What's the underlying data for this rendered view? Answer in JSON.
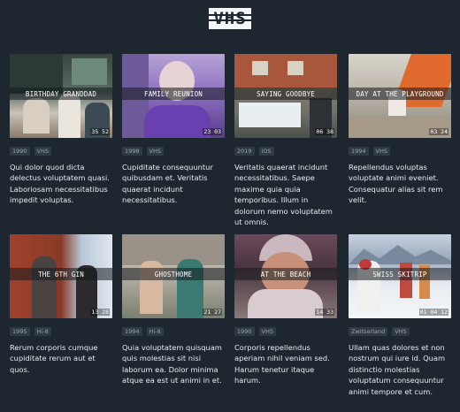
{
  "header": {
    "logo_text": "VHS"
  },
  "videos": [
    {
      "title": "BIRTHDAY GRANDDAD",
      "duration": "35 52",
      "tags": [
        "1990",
        "VHS"
      ],
      "description": "Qui dolor quod dicta delectus voluptatem quasi. Laboriosam necessitatibus impedit voluptas."
    },
    {
      "title": "FAMILY REUNION",
      "duration": "23 03",
      "tags": [
        "1998",
        "VHS"
      ],
      "description": "Cupiditate consequuntur quibusdam et. Veritatis quaerat incidunt necessitatibus."
    },
    {
      "title": "SAYING GOODBYE",
      "duration": "06 38",
      "tags": [
        "2019",
        "iOS"
      ],
      "description": "Veritatis quaerat incidunt necessitatibus. Saepe maxime quia quia temporibus. Illum in dolorum nemo voluptatem ut omnis."
    },
    {
      "title": "DAY AT THE PLAYGROUND",
      "duration": "03 24",
      "tags": [
        "1994",
        "VHS"
      ],
      "description": "Repellendus voluptas voluptate animi eveniet. Consequatur alias sit rem velit."
    },
    {
      "title": "THE 6TH GIN",
      "duration": "13 28",
      "tags": [
        "1995",
        "Hi-8"
      ],
      "description": "Rerum corporis cumque cupiditate rerum aut et quos."
    },
    {
      "title": "GHOSTHOME",
      "duration": "21 27",
      "tags": [
        "1994",
        "Hi-8"
      ],
      "description": "Quia voluptatem quisquam quis molestias sit nisi laborum ea. Dolor minima atque ea est ut animi in et."
    },
    {
      "title": "AT THE BEACH",
      "duration": "14 33",
      "tags": [
        "1990",
        "VHS"
      ],
      "description": "Corporis repellendus aperiam nihil veniam sed. Harum tenetur itaque harum."
    },
    {
      "title": "SWISS SKITRIP",
      "duration": "01 04 12",
      "tags": [
        "Zwitserland",
        "VHS"
      ],
      "description": "Ullam quas dolores et non nostrum qui iure id. Quam distinctio molestias voluptatum consequuntur animi tempore et cum."
    }
  ]
}
